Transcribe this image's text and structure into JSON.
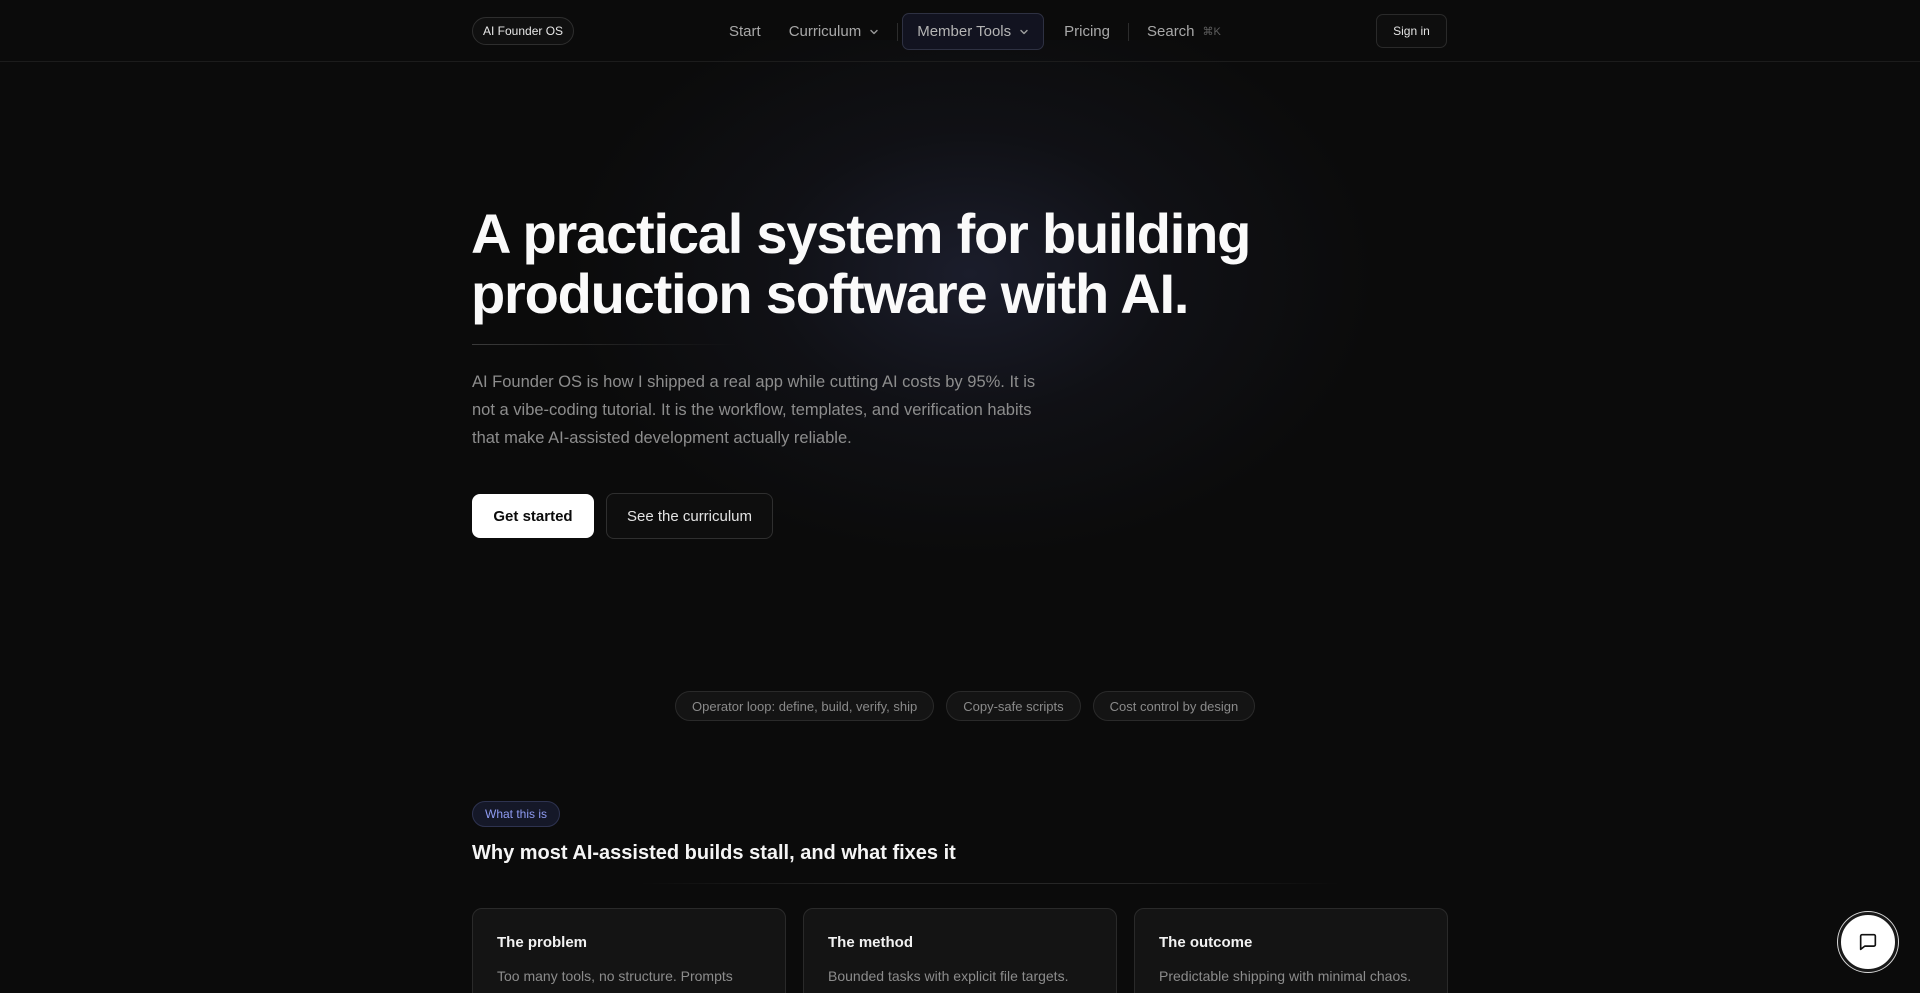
{
  "nav": {
    "brand": "AI Founder OS",
    "items": {
      "start": "Start",
      "curriculum": "Curriculum",
      "member_tools": "Member Tools",
      "pricing": "Pricing",
      "search": "Search",
      "search_shortcut": "⌘K"
    },
    "sign_in": "Sign in"
  },
  "hero": {
    "title_line1": "A practical system for building",
    "title_line2": "production software with AI.",
    "description": "AI Founder OS is how I shipped a real app while cutting AI costs by 95%. It is not a vibe-coding tutorial. It is the workflow, templates, and verification habits that make AI-assisted development actually reliable.",
    "cta_primary": "Get started",
    "cta_secondary": "See the curriculum"
  },
  "pills": [
    "Operator loop: define, build, verify, ship",
    "Copy-safe scripts",
    "Cost control by design"
  ],
  "section": {
    "badge": "What this is",
    "title": "Why most AI-assisted builds stall, and what fixes it",
    "cards": [
      {
        "title": "The problem",
        "body": "Too many tools, no structure. Prompts"
      },
      {
        "title": "The method",
        "body": "Bounded tasks with explicit file targets."
      },
      {
        "title": "The outcome",
        "body": "Predictable shipping with minimal chaos."
      }
    ]
  },
  "icons": {
    "curriculum_chevron": "chevron-down-icon",
    "member_tools_chevron": "chevron-down-icon",
    "chat": "chat-bubble-icon"
  }
}
